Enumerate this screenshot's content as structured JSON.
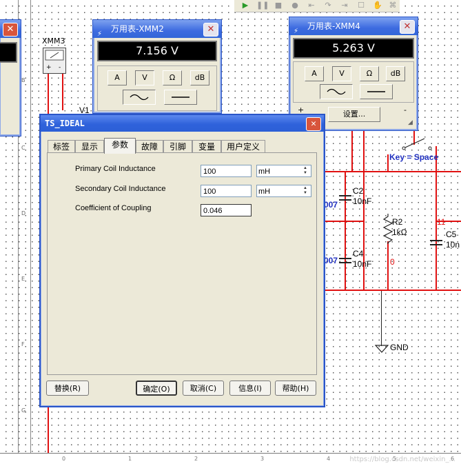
{
  "toolbar": {
    "play_icon": "play-icon",
    "pause_icon": "pause-icon",
    "stop_icon": "stop-icon",
    "record_icon": "record-icon"
  },
  "schematic": {
    "xmm3_label": "XMM3",
    "v1_label": "V1",
    "c2_label": "C2",
    "c2_value": "10nF",
    "c4_label": "C4",
    "c4_value": "10nF",
    "r2_label": "R2",
    "r2_value": "1kΩ",
    "c5_label": "C5",
    "c5_value": "10n",
    "net_007_a": "007",
    "net_007_b": "007",
    "net_0": "0",
    "net_11": "11",
    "key_label": "Key = Space",
    "gnd_label": "GND",
    "ruler_letters": [
      "B",
      "C",
      "D",
      "E",
      "F",
      "G"
    ],
    "ruler_numbers": [
      "0",
      "1",
      "2",
      "3",
      "4",
      "5",
      "6"
    ],
    "watermark": "https://blog.csdn.net/weixin_..."
  },
  "meter_xmm2": {
    "title": "万用表-XMM2",
    "reading": "7.156 V",
    "btn_a": "A",
    "btn_v": "V",
    "btn_ohm": "Ω",
    "btn_db": "dB"
  },
  "meter_xmm4": {
    "title": "万用表-XMM4",
    "reading": "5.263 V",
    "btn_a": "A",
    "btn_v": "V",
    "btn_ohm": "Ω",
    "btn_db": "dB",
    "settings_label": "设置..."
  },
  "dialog": {
    "title": "TS_IDEAL",
    "tabs": [
      "标签",
      "显示",
      "参数",
      "故障",
      "引脚",
      "变量",
      "用户定义"
    ],
    "active_tab": "参数",
    "params": [
      {
        "label": "Primary Coil Inductance",
        "value": "100",
        "unit": "mH"
      },
      {
        "label": "Secondary Coil Inductance",
        "value": "100",
        "unit": "mH"
      },
      {
        "label": "Coefficient of Coupling",
        "value": "0.046"
      }
    ],
    "buttons": {
      "replace": "替换(R)",
      "ok": "确定(O)",
      "cancel": "取消(C)",
      "info": "信息(I)",
      "help": "帮助(H)"
    }
  }
}
